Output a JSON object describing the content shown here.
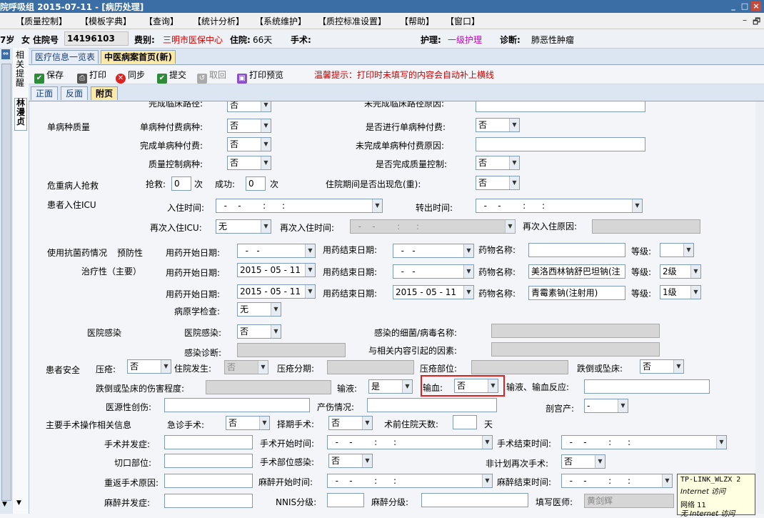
{
  "titlebar": {
    "text": "院呼吸组  2015-07-11 - [病历处理]",
    "min": "_",
    "restore": "□",
    "close": "×"
  },
  "menu": [
    "【质量控制】",
    "【模板字典】",
    "【查询】",
    "【统计分析】",
    "【系统维护】",
    "【质控标准设置】",
    "【帮助】",
    "【窗口】"
  ],
  "menu_buttons": {
    "min": "–",
    "restore": "🗗"
  },
  "info": {
    "age": "7岁",
    "gender": "女",
    "inpatient_label": "住院号",
    "inpatient_no": "14196103",
    "payer_label": "费别:",
    "payer": "三明市医保中心",
    "stay_label": "住院:",
    "stay": "66天",
    "surgery_label": "手术:",
    "care_label": "护理:",
    "care": "一级护理",
    "diag_label": "诊断:",
    "diag": "肺恶性肿瘤"
  },
  "side_tabs": [
    "相关提醒",
    "林漫贞"
  ],
  "tabs1": [
    "医疗信息一览表",
    "中医病案首页(新)"
  ],
  "toolbar": {
    "save": "保存",
    "print": "打印",
    "sync": "同步",
    "submit": "提交",
    "retrieve": "取回",
    "preview": "打印预览",
    "tip": "温馨提示：打印时未填写的内容会自动补上横线"
  },
  "tabs2": [
    "正面",
    "反面",
    "附页"
  ],
  "form": {
    "clinical_path_done": "完成临床路径:",
    "clinical_path_done_val": "否",
    "clinical_path_fail_reason": "未完成临床路径原因:",
    "single_disease_quality": "单病种质量",
    "single_pay": "单病种付费病种:",
    "single_pay_val": "否",
    "single_pay_done_q": "是否进行单病种付费:",
    "single_pay_done_q_val": "否",
    "finish_single_pay": "完成单病种付费:",
    "finish_single_pay_val": "否",
    "unfinish_single_pay_reason": "未完成单病种付费原因:",
    "quality_disease": "质量控制病种:",
    "quality_disease_val": "否",
    "quality_done_q": "是否完成质量控制:",
    "quality_done_q_val": "否",
    "critical_rescue": "危重病人抢救",
    "rescue": "抢救:",
    "rescue_val": "0",
    "times": "次",
    "success": "成功:",
    "success_val": "0",
    "critical_occur": "住院期间是否出现危(重):",
    "critical_occur_val": "否",
    "icu": "患者入住ICU",
    "icu_in": "入住时间:",
    "icu_in_val": "  -    -        :      :",
    "icu_out": "转出时间:",
    "icu_out_val": "  -    -        :      :",
    "icu_again": "再次入住ICU:",
    "icu_again_val": "无",
    "icu_again_time": "再次入住时间:",
    "icu_again_time_val": "  -    -        :      :",
    "icu_again_reason": "再次入住原因:",
    "antibiotic": "使用抗菌药情况",
    "prevent": "预防性",
    "therapy": "治疗性（主要）",
    "drug_start": "用药开始日期:",
    "drug_end": "用药结束日期:",
    "drug_name": "药物名称:",
    "grade": "等级:",
    "row1_start": "  -   -",
    "row1_end": "  -   -",
    "row1_name": "",
    "row1_grade": "",
    "row2_start": "2015 - 05 - 11",
    "row2_end": "  -   -",
    "row2_name": "美洛西林钠舒巴坦钠(注",
    "row2_grade": "2级",
    "row3_start": "2015 - 05 - 11",
    "row3_end": "2015 - 05 - 11",
    "row3_name": "青霉素钠(注射用)",
    "row3_grade": "1级",
    "pathogen": "病原学检查:",
    "pathogen_val": "无",
    "hosp_infect_title": "医院感染",
    "hosp_infect": "医院感染:",
    "hosp_infect_val": "否",
    "infect_name": "感染的细菌/病毒名称:",
    "infect_diag": "感染诊断:",
    "related_factor": "与相关内容引起的因素:",
    "safety": "患者安全",
    "pressure": "压疮:",
    "pressure_val": "否",
    "in_hosp_occur": "住院发生:",
    "in_hosp_occur_val": "否",
    "pressure_stage": "压疮分期:",
    "pressure_site": "压疮部位:",
    "fall": "跌倒或坠床:",
    "fall_val": "否",
    "fall_harm": "跌倒或坠床的伤害程度:",
    "infusion": "输液:",
    "infusion_val": "是",
    "transfusion": "输血:",
    "transfusion_val": "否",
    "infusion_reaction": "输液、输血反应:",
    "iatrogenic": "医源性创伤:",
    "birth_injury": "产伤情况:",
    "cesarean": "剖宫产:",
    "cesarean_val": "-",
    "surgery_info": "主要手术操作相关信息",
    "emergency_surgery": "急诊手术:",
    "emergency_surgery_val": "否",
    "elective_surgery": "择期手术:",
    "elective_surgery_val": "否",
    "preop_days": "术前住院天数:",
    "days": "天",
    "complication": "手术并发症:",
    "op_start": "手术开始时间:",
    "op_start_val": "  -    -        :      :",
    "op_end": "手术结束时间:",
    "op_end_val": "  -    -        :      :",
    "incision": "切口部位:",
    "site_infect": "手术部位感染:",
    "site_infect_val": "否",
    "unplanned": "非计划再次手术:",
    "unplanned_val": "否",
    "return_reason": "重返手术原因:",
    "anes_start": "麻醉开始时间:",
    "anes_start_val": "  -    -        :      :",
    "anes_end": "麻醉结束时间:",
    "anes_end_val": "  -    -        :      :",
    "anes_complication": "麻醉并发症:",
    "nnis": "NNIS分级:",
    "anes_grade": "麻醉分级:",
    "doctor": "填写医师:",
    "doctor_val": "黄剑辉"
  },
  "tooltip": {
    "line1": "TP-LINK_WLZX  2",
    "line2": "Internet 访问",
    "line3": "网络  11",
    "line4": "无 Internet 访问"
  },
  "colors": {
    "title_bg": "#3a6ea5",
    "red": "#e02020",
    "payer": "#d00000",
    "care": "#cc00cc",
    "tip": "#d00000"
  }
}
